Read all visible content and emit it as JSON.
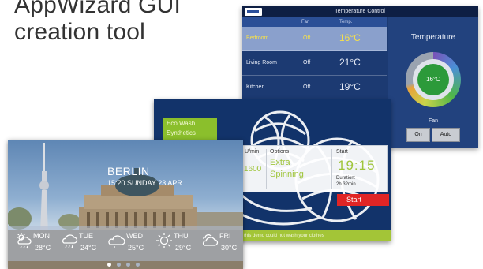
{
  "headline": {
    "line1": "AppWizard GUI",
    "line2": "creation tool"
  },
  "temperature_control": {
    "window_title": "Temperature Control",
    "columns": {
      "fan": "Fan",
      "temp": "Temp."
    },
    "rooms": [
      {
        "name": "Bedroom",
        "fan": "Off",
        "temp": "16°C",
        "selected": true
      },
      {
        "name": "Living Room",
        "fan": "Off",
        "temp": "21°C",
        "selected": false
      },
      {
        "name": "Kitchen",
        "fan": "Off",
        "temp": "19°C",
        "selected": false
      }
    ],
    "panel_title": "Temperature",
    "gauge_value": "16°C",
    "fan_label": "Fan",
    "fan_buttons": [
      "On",
      "Auto"
    ],
    "colors": {
      "background": "#1c3a72",
      "selected_row": "#8aa0cc",
      "highlight_text": "#f6e04a"
    }
  },
  "eco_wash": {
    "program_line1": "Eco Wash",
    "program_line2": "Synthetics",
    "speed_header": "U/min",
    "speed_value": "1600",
    "options_header": "Options",
    "options_line1": "Extra",
    "options_line2": "Spinning",
    "start_header": "Start",
    "start_time": "19:15",
    "duration_label": "Duration:",
    "duration_value": "2h 32min",
    "start_button": "Start",
    "footer_text": "this demo could not wash your clothes",
    "colors": {
      "accent": "#8bbf2c",
      "start": "#e02525"
    }
  },
  "weather": {
    "city": "BERLIN",
    "datetime": "15:20 SUNDAY 23 APR",
    "forecast": [
      {
        "day": "MON",
        "temp": "28°C",
        "icon": "sun-rain-icon"
      },
      {
        "day": "TUE",
        "temp": "24°C",
        "icon": "cloud-rain-icon"
      },
      {
        "day": "WED",
        "temp": "25°C",
        "icon": "cloud-icon"
      },
      {
        "day": "THU",
        "temp": "29°C",
        "icon": "sun-icon"
      },
      {
        "day": "FRI",
        "temp": "30°C",
        "icon": "sun-cloud-icon"
      }
    ],
    "pager": {
      "pages": 4,
      "active": 0
    }
  }
}
